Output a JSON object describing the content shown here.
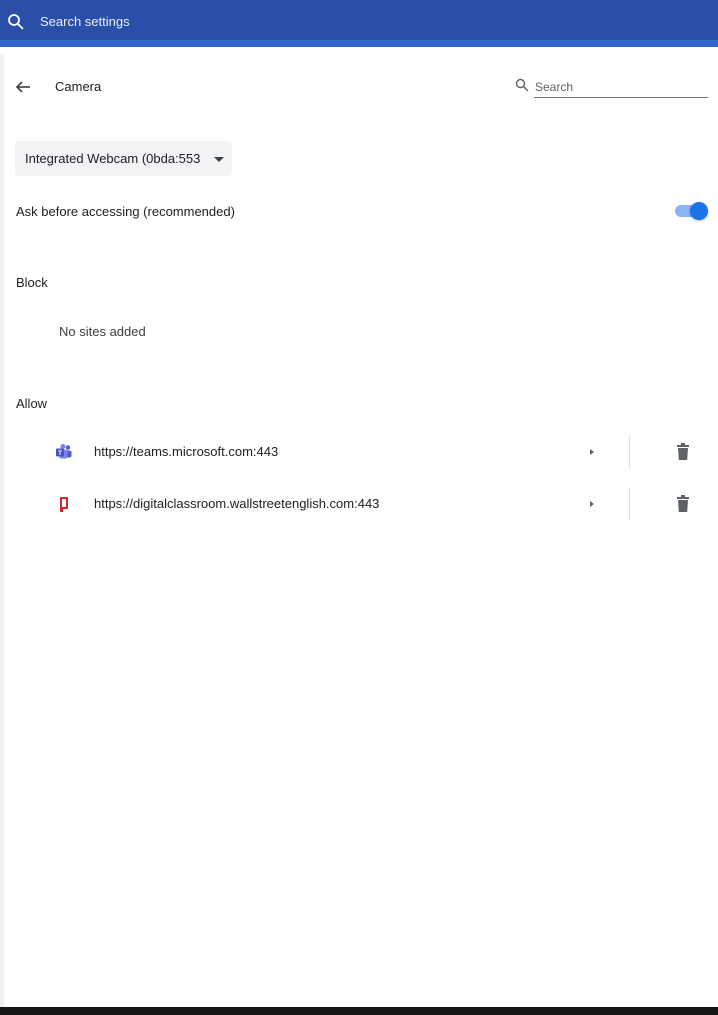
{
  "topbar": {
    "search_placeholder": "Search settings",
    "color": "#2a4fa8"
  },
  "subheader": {
    "title": "Camera",
    "search_placeholder": "Search"
  },
  "device": {
    "selected": "Integrated Webcam (0bda:553"
  },
  "ask": {
    "label": "Ask before accessing (recommended)",
    "enabled": true,
    "accent": "#1a73e8"
  },
  "block": {
    "title": "Block",
    "empty": "No sites added"
  },
  "allow": {
    "title": "Allow",
    "sites": [
      {
        "url": "https://teams.microsoft.com:443",
        "icon": "teams-icon"
      },
      {
        "url": "https://digitalclassroom.wallstreetenglish.com:443",
        "icon": "wallstreet-icon"
      }
    ]
  },
  "icons": {
    "search": "search-icon",
    "back": "arrow-left-icon",
    "expand": "arrow-right-icon",
    "delete": "trash-icon",
    "dropdown": "caret-down-icon"
  }
}
